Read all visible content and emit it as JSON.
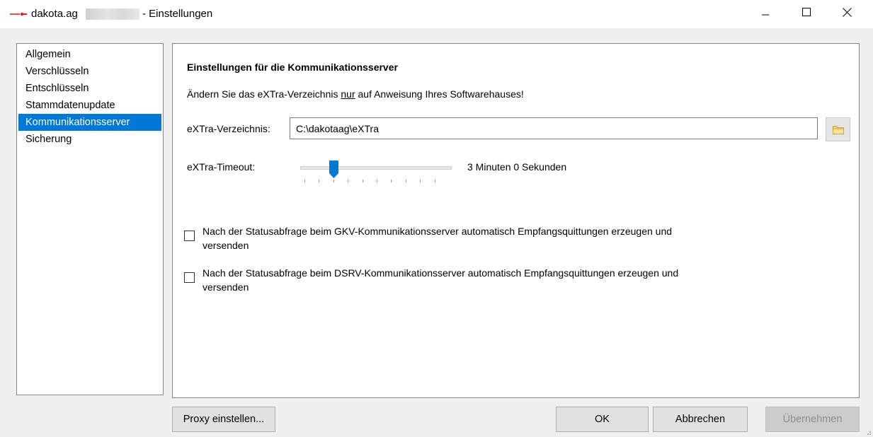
{
  "window": {
    "title_prefix": "dakota.ag",
    "title_suffix": "- Einstellungen",
    "logo_icon": "dakota-logo-icon",
    "controls": [
      "minimize-icon",
      "maximize-icon",
      "close-icon"
    ]
  },
  "sidebar": {
    "items": [
      {
        "label": "Allgemein",
        "selected": false
      },
      {
        "label": "Verschlüsseln",
        "selected": false
      },
      {
        "label": "Entschlüsseln",
        "selected": false
      },
      {
        "label": "Stammdatenupdate",
        "selected": false
      },
      {
        "label": "Kommunikationsserver",
        "selected": true
      },
      {
        "label": "Sicherung",
        "selected": false
      }
    ]
  },
  "panel": {
    "heading": "Einstellungen für die Kommunikationsserver",
    "notice_before": "Ändern Sie das eXTra-Verzeichnis ",
    "notice_underlined": "nur",
    "notice_after": " auf Anweisung Ihres Softwarehauses!",
    "dir_label": "eXTra-Verzeichnis:",
    "dir_value": "C:\\dakotaag\\eXTra",
    "browse_icon": "folder-icon",
    "timeout_label": "eXTra-Timeout:",
    "timeout_value": "3 Minuten 0 Sekunden",
    "timeout_slider": {
      "position": 2,
      "tick_count": 10
    },
    "checkbox_gkv": {
      "checked": false,
      "label": "Nach der Statusabfrage beim GKV-Kommunikationsserver automatisch Empfangsquittungen erzeugen und versenden"
    },
    "checkbox_dsrv": {
      "checked": false,
      "label": "Nach der Statusabfrage beim DSRV-Kommunikationsserver automatisch Empfangsquittungen erzeugen und versenden"
    }
  },
  "buttons": {
    "proxy": "Proxy einstellen...",
    "ok": "OK",
    "cancel": "Abbrechen",
    "apply": "Übernehmen"
  },
  "colors": {
    "selection": "#0078d7",
    "slider_thumb": "#0078d7"
  }
}
